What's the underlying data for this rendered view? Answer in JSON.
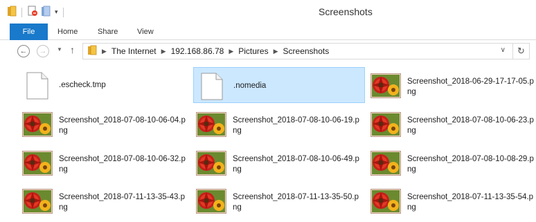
{
  "window": {
    "title": "Screenshots"
  },
  "ribbon": {
    "file": "File",
    "home": "Home",
    "share": "Share",
    "view": "View"
  },
  "address": {
    "crumbs": [
      "The Internet",
      "192.168.86.78",
      "Pictures",
      "Screenshots"
    ]
  },
  "files": [
    {
      "name": ".escheck.tmp",
      "type": "document",
      "selected": false
    },
    {
      "name": ".nomedia",
      "type": "document",
      "selected": true
    },
    {
      "name": "Screenshot_2018-06-29-17-17-05.png",
      "type": "image",
      "selected": false
    },
    {
      "name": "Screenshot_2018-07-08-10-06-04.png",
      "type": "image",
      "selected": false
    },
    {
      "name": "Screenshot_2018-07-08-10-06-19.png",
      "type": "image",
      "selected": false
    },
    {
      "name": "Screenshot_2018-07-08-10-06-23.png",
      "type": "image",
      "selected": false
    },
    {
      "name": "Screenshot_2018-07-08-10-06-32.png",
      "type": "image",
      "selected": false
    },
    {
      "name": "Screenshot_2018-07-08-10-06-49.png",
      "type": "image",
      "selected": false
    },
    {
      "name": "Screenshot_2018-07-08-10-08-29.png",
      "type": "image",
      "selected": false
    },
    {
      "name": "Screenshot_2018-07-11-13-35-43.png",
      "type": "image",
      "selected": false
    },
    {
      "name": "Screenshot_2018-07-11-13-35-50.png",
      "type": "image",
      "selected": false
    },
    {
      "name": "Screenshot_2018-07-11-13-35-54.png",
      "type": "image",
      "selected": false
    }
  ],
  "icons": {
    "folder": "folder-icon",
    "properties": "properties-icon",
    "new_folder": "new-folder-icon",
    "customize": "customize-toolbar-icon",
    "back": "back-arrow-icon",
    "forward": "forward-arrow-icon",
    "up": "up-arrow-icon",
    "refresh": "refresh-icon"
  },
  "colors": {
    "accent": "#1979ca",
    "selection": "#cce8ff",
    "selection_border": "#99d1ff"
  }
}
